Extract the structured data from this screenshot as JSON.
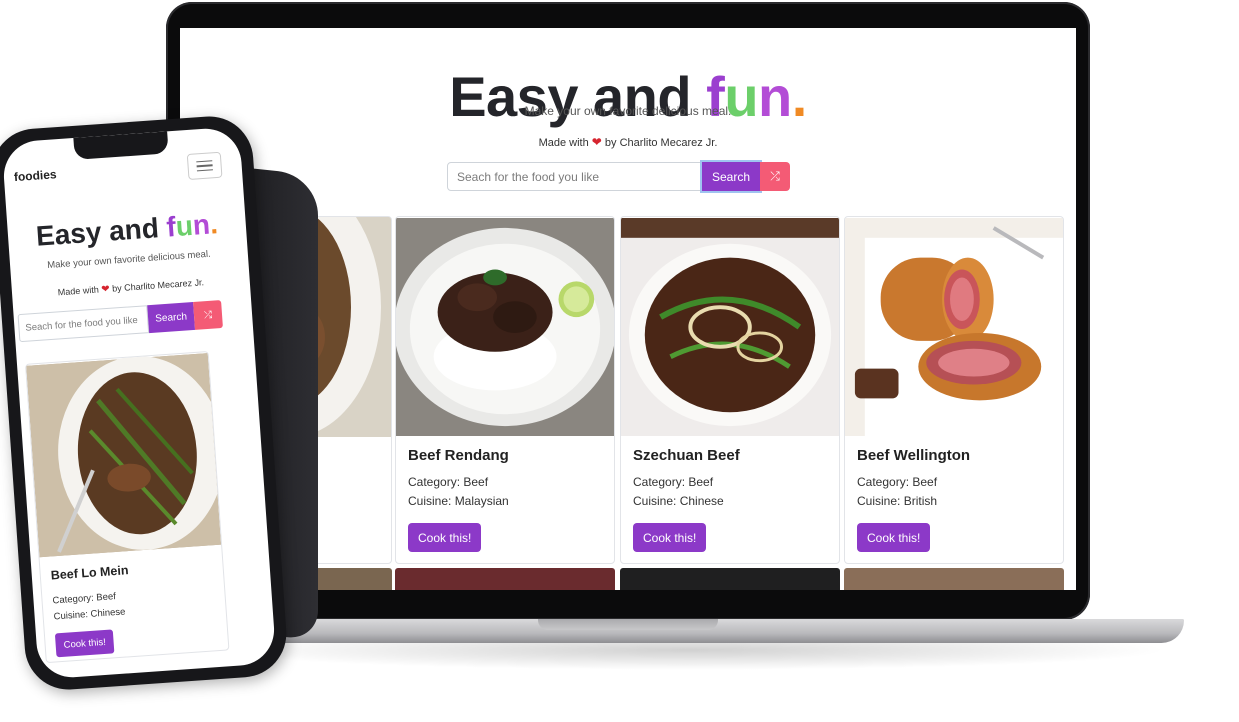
{
  "hero": {
    "title_prefix": "Easy and ",
    "title_f": "f",
    "title_u": "u",
    "title_n": "n",
    "title_dot": ".",
    "subtitle": "Make your own favorite delicious meal.",
    "made_prefix": "Made with",
    "heart": "❤",
    "made_suffix": "by Charlito Mecarez Jr."
  },
  "search": {
    "placeholder": "Seach for the food you like",
    "button_label": "Search",
    "shuffle_icon": "⤮"
  },
  "colors": {
    "accent_purple": "#8c39c8",
    "shuffle_pink": "#f45b75",
    "fun_green": "#6ccf6a",
    "fun_orange": "#f08a24"
  },
  "cards": [
    {
      "title": "Beef Rendang",
      "category": "Category: Beef",
      "cuisine": "Cuisine: Malaysian",
      "button": "Cook this!"
    },
    {
      "title": "Szechuan Beef",
      "category": "Category: Beef",
      "cuisine": "Cuisine: Chinese",
      "button": "Cook this!"
    },
    {
      "title": "Beef Wellington",
      "category": "Category: Beef",
      "cuisine": "Cuisine: British",
      "button": "Cook this!"
    }
  ],
  "mobile": {
    "brand": "foodies",
    "card": {
      "title": "Beef Lo Mein",
      "category": "Category: Beef",
      "cuisine": "Cuisine: Chinese",
      "button": "Cook this!"
    }
  }
}
